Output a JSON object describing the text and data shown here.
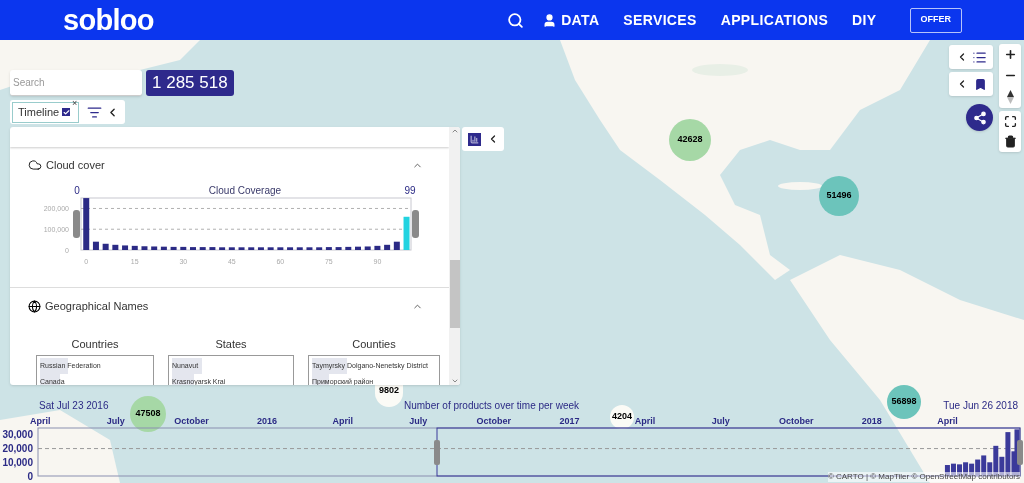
{
  "header": {
    "logo": "sobloo",
    "nav_links": [
      "DATA",
      "SERVICES",
      "APPLICATIONS",
      "DIY"
    ],
    "offer_button": "OFFER"
  },
  "search": {
    "placeholder": "Search"
  },
  "product_count": "1 285 518",
  "filter_chip": {
    "label": "Timeline",
    "checked": true,
    "close": "×"
  },
  "panel": {
    "sections": [
      {
        "kind": "histogram",
        "title": "Cloud cover",
        "expanded": true,
        "range_min": "0",
        "range_max": "99",
        "chart_data": {
          "type": "bar",
          "title": "Cloud Coverage",
          "x": [
            0,
            3,
            6,
            9,
            12,
            15,
            18,
            21,
            24,
            27,
            30,
            33,
            36,
            39,
            42,
            45,
            48,
            51,
            54,
            57,
            60,
            63,
            66,
            69,
            72,
            75,
            78,
            81,
            84,
            87,
            90,
            93,
            96,
            99
          ],
          "series": [
            {
              "color": "#2b2a85",
              "values": [
                250000,
                40000,
                30000,
                25000,
                22000,
                20000,
                18000,
                17000,
                16000,
                15000,
                15000,
                14000,
                14000,
                14000,
                13000,
                13000,
                13000,
                13000,
                13000,
                13000,
                13000,
                13000,
                13000,
                13000,
                13000,
                14000,
                14000,
                15000,
                16000,
                17000,
                20000,
                25000,
                40000,
                null
              ]
            },
            {
              "color": "#22d3e0",
              "values": [
                null,
                null,
                null,
                null,
                null,
                null,
                null,
                null,
                null,
                null,
                null,
                null,
                null,
                null,
                null,
                null,
                null,
                null,
                null,
                null,
                null,
                null,
                null,
                null,
                null,
                null,
                null,
                null,
                null,
                null,
                null,
                null,
                null,
                160000
              ]
            }
          ],
          "xlim": [
            -1,
            101
          ],
          "ylim": [
            0,
            260000
          ],
          "xticks": [
            0,
            15,
            30,
            45,
            60,
            75,
            90
          ],
          "yticks": [
            {
              "value": 0,
              "label": "0"
            },
            {
              "value": 100000,
              "label": "100,000"
            },
            {
              "value": 200000,
              "label": "200,000"
            }
          ]
        }
      },
      {
        "kind": "names",
        "title": "Geographical Names",
        "expanded": true,
        "columns": [
          {
            "title": "Countries",
            "items": [
              {
                "name": "Russian Federation",
                "level": 0.25
              },
              {
                "name": "Canada",
                "level": 0.18
              }
            ]
          },
          {
            "title": "States",
            "items": [
              {
                "name": "Nunavut",
                "level": 0.25
              },
              {
                "name": "Krasnoyarsk Krai",
                "level": 0.19
              }
            ]
          },
          {
            "title": "Counties",
            "items": [
              {
                "name": "Taymyrsky Dolgano-Nenetsky District",
                "level": 0.28
              },
              {
                "name": "Приморский район",
                "level": 0.14
              }
            ]
          }
        ]
      }
    ]
  },
  "chart_toggle": {
    "on": true
  },
  "clusters": [
    {
      "count": "42628",
      "color": "#a6d8a6"
    },
    {
      "count": "51496",
      "color": "#6cc4bb"
    },
    {
      "count": "9802",
      "color": "#fbfbf6"
    },
    {
      "count": "47508",
      "color": "#a6d8a6"
    },
    {
      "count": "4204",
      "color": "#fbfbf6"
    },
    {
      "count": "56898",
      "color": "#6cc4bb"
    }
  ],
  "timeline": {
    "range_start": "Sat Jul 23 2016",
    "range_end": "Tue Jun 26 2018",
    "chart_data": {
      "type": "bar",
      "title": "Number of products over time per week",
      "x": [
        2018.25,
        2018.27,
        2018.29,
        2018.31,
        2018.33,
        2018.35,
        2018.37,
        2018.39,
        2018.41,
        2018.43,
        2018.45,
        2018.47,
        2018.48
      ],
      "series": [
        {
          "color": "#3b3a9a",
          "values": [
            8000,
            9000,
            8500,
            10000,
            9000,
            12000,
            15000,
            10000,
            22000,
            14000,
            32000,
            18000,
            34000
          ]
        }
      ],
      "xlim": [
        2015.2425,
        2018.49
      ],
      "ylim": [
        0,
        35000
      ],
      "xticks": [
        {
          "value": 2015.25,
          "label": "April"
        },
        {
          "value": 2015.5,
          "label": "July"
        },
        {
          "value": 2015.75,
          "label": "October"
        },
        {
          "value": 2016,
          "label": "2016"
        },
        {
          "value": 2016.25,
          "label": "April"
        },
        {
          "value": 2016.5,
          "label": "July"
        },
        {
          "value": 2016.75,
          "label": "October"
        },
        {
          "value": 2017,
          "label": "2017"
        },
        {
          "value": 2017.25,
          "label": "April"
        },
        {
          "value": 2017.5,
          "label": "July"
        },
        {
          "value": 2017.75,
          "label": "October"
        },
        {
          "value": 2018,
          "label": "2018"
        },
        {
          "value": 2018.25,
          "label": "April"
        }
      ],
      "yticks": [
        {
          "value": 0,
          "label": "0"
        },
        {
          "value": 10000,
          "label": "10,000"
        },
        {
          "value": 20000,
          "label": "20,000"
        },
        {
          "value": 30000,
          "label": "30,000"
        }
      ],
      "ref_lines": [
        {
          "axis": "y",
          "value": 20000
        }
      ]
    }
  },
  "attribution": "© CARTO | © MapTiler © OpenStreetMap contributors"
}
